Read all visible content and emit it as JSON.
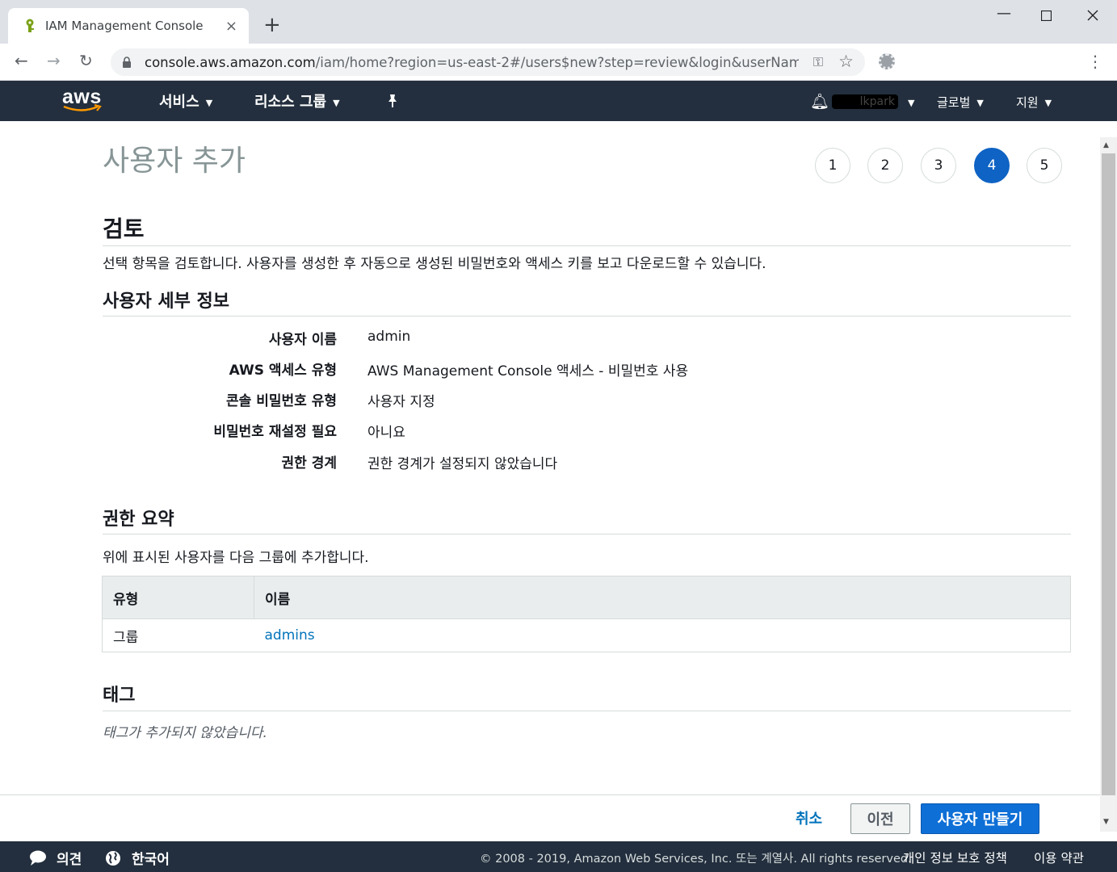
{
  "browser": {
    "tab_title": "IAM Management Console",
    "tab_close": "×",
    "new_tab": "+",
    "url_host": "console.aws.amazon.com",
    "url_path": "/iam/home?region=us-east-2#/users$new?step=review&login&userName..."
  },
  "awsnav": {
    "logo": "aws",
    "services": "서비스",
    "resource_groups": "리소스 그룹",
    "account_name": "lkpark",
    "region": "글로벌",
    "support": "지원"
  },
  "page": {
    "title": "사용자 추가",
    "steps": [
      "1",
      "2",
      "3",
      "4",
      "5"
    ],
    "active_step": 4,
    "review_heading": "검토",
    "review_desc": "선택 항목을 검토합니다. 사용자를 생성한 후 자동으로 생성된 비밀번호와 액세스 키를 보고 다운로드할 수 있습니다.",
    "details_heading": "사용자 세부 정보",
    "details": [
      {
        "label": "사용자 이름",
        "value": "admin"
      },
      {
        "label": "AWS 액세스 유형",
        "value": "AWS Management Console 액세스 - 비밀번호 사용"
      },
      {
        "label": "콘솔 비밀번호 유형",
        "value": "사용자 지정"
      },
      {
        "label": "비밀번호 재설정 필요",
        "value": "아니요"
      },
      {
        "label": "권한 경계",
        "value": "권한 경계가 설정되지 않았습니다"
      }
    ],
    "permissions_heading": "권한 요약",
    "permissions_desc": "위에 표시된 사용자를 다음 그룹에 추가합니다.",
    "table": {
      "headers": [
        "유형",
        "이름"
      ],
      "rows": [
        [
          "그룹",
          "admins"
        ]
      ]
    },
    "tags_heading": "태그",
    "tags_empty": "태그가 추가되지 않았습니다."
  },
  "actions": {
    "cancel": "취소",
    "previous": "이전",
    "create": "사용자 만들기"
  },
  "footer": {
    "feedback": "의견",
    "language": "한국어",
    "copyright": "© 2008 - 2019, Amazon Web Services, Inc. 또는 계열사. All rights reserved.",
    "privacy": "개인 정보 보호 정책",
    "terms": "이용 약관"
  },
  "colors": {
    "aws_nav": "#232f3e",
    "primary": "#0e6fd6",
    "link": "#0073bb",
    "aws_orange": "#ff9900"
  }
}
